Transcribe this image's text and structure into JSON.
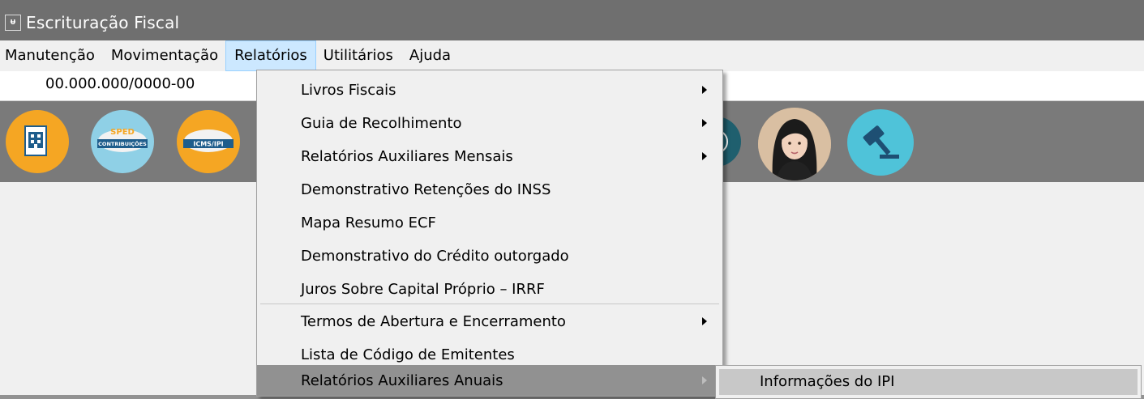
{
  "window": {
    "title": "Escrituração Fiscal"
  },
  "menubar": {
    "items": [
      {
        "label": "Manutenção"
      },
      {
        "label": "Movimentação"
      },
      {
        "label": "Relatórios"
      },
      {
        "label": "Utilitários"
      },
      {
        "label": "Ajuda"
      }
    ],
    "active": "Relatórios"
  },
  "company": {
    "cnpj": "00.000.000/0000-00"
  },
  "toolbar": {
    "icons": [
      {
        "name": "building-document-icon",
        "color": "#f5a623"
      },
      {
        "name": "sped-contribuicoes-icon",
        "text_top": "SPED",
        "text_bottom": "CONTRIBUIÇÕES",
        "color": "#8fd0e6"
      },
      {
        "name": "icms-ipi-icon",
        "text": "ICMS/IPI",
        "color": "#f5a623"
      },
      {
        "name": "info-icon",
        "color": "#1f5f6e"
      },
      {
        "name": "assistant-avatar-icon",
        "color": "#c9a27a"
      },
      {
        "name": "gavel-icon",
        "color": "#4fc3d9"
      }
    ]
  },
  "relatorios_menu": {
    "items": [
      {
        "label": "Livros Fiscais",
        "submenu": true
      },
      {
        "label": "Guia de Recolhimento",
        "submenu": true
      },
      {
        "label": "Relatórios Auxiliares Mensais",
        "submenu": true
      },
      {
        "label": "Demonstrativo Retenções do INSS",
        "submenu": false
      },
      {
        "label": "Mapa Resumo ECF",
        "submenu": false
      },
      {
        "label": "Demonstrativo do Crédito outorgado",
        "submenu": false
      },
      {
        "label": "Juros Sobre Capital Próprio – IRRF",
        "submenu": false
      },
      {
        "label": "Termos de Abertura e Encerramento",
        "submenu": true
      },
      {
        "label": "Lista de Código de Emitentes",
        "submenu": false
      },
      {
        "label": "Relatórios Auxiliares Anuais",
        "submenu": true,
        "highlighted": true
      }
    ]
  },
  "anuais_submenu": {
    "items": [
      {
        "label": "Informações do IPI",
        "highlighted": true
      }
    ]
  }
}
